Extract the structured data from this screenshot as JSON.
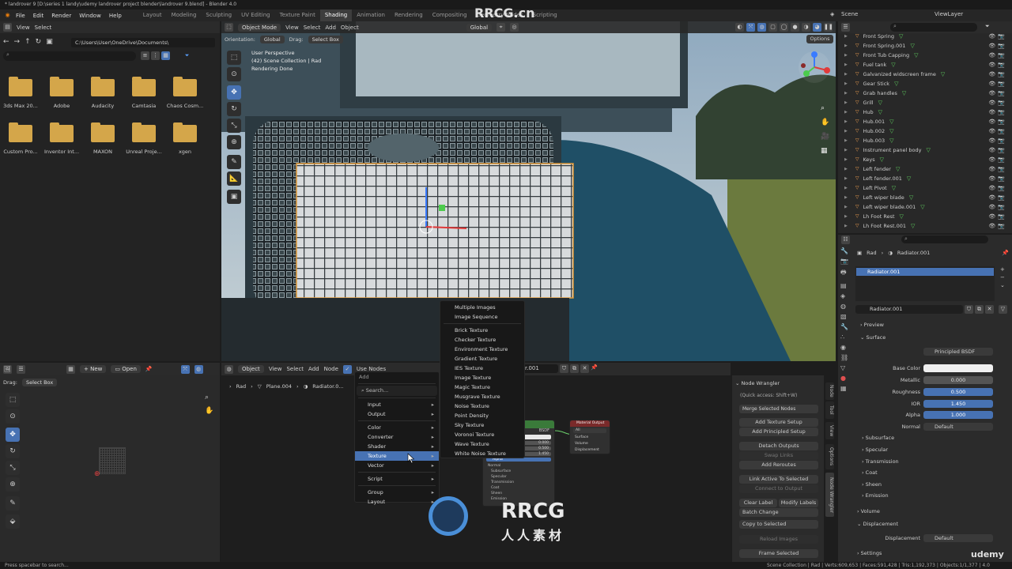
{
  "window_title": "* landrover 9 [D:\\series 1 landy\\udemy landrover project blender\\landrover 9.blend] - Blender 4.0",
  "menus": [
    "File",
    "Edit",
    "Render",
    "Window",
    "Help"
  ],
  "workspaces": [
    "Layout",
    "Modeling",
    "Sculpting",
    "UV Editing",
    "Texture Paint",
    "Shading",
    "Animation",
    "Rendering",
    "Compositing",
    "Geometry Nodes",
    "Scripting"
  ],
  "active_workspace": "Shading",
  "scene": {
    "label": "Scene",
    "view_layer": "ViewLayer"
  },
  "file_browser": {
    "menus": [
      "View",
      "Select"
    ],
    "path": "C:\\Users\\User\\OneDrive\\Documents\\",
    "folders": [
      "3ds Max 20...",
      "Adobe",
      "Audacity",
      "Camtasia",
      "Chaos Cosm...",
      "Custom Pro...",
      "Inventor Int...",
      "MAXON",
      "Unreal Proje...",
      "xgen"
    ]
  },
  "viewport": {
    "mode": "Object Mode",
    "menus": [
      "View",
      "Select",
      "Add",
      "Object"
    ],
    "transform": "Global",
    "orientation_label": "Orientation:",
    "orientation_value": "Global",
    "drag_label": "Drag:",
    "drag_value": "Select Box",
    "options": "Options",
    "overlay_lines": [
      "User Perspective",
      "(42) Scene Collection | Rad",
      "Rendering Done"
    ]
  },
  "outliner": {
    "items": [
      "Front Spring",
      "Front Spring.001",
      "Front Tub Capping",
      "Fuel tank",
      "Galvanized widscreen frame",
      "Gear Stick",
      "Grab handles",
      "Grill",
      "Hub",
      "Hub.001",
      "Hub.002",
      "Hub.003",
      "Instrument panel body",
      "Keys",
      "Left fender",
      "Left fender.001",
      "Left Pivot",
      "Left wiper blade",
      "Left wiper blade.001",
      "Lh Foot Rest",
      "Lh Foot Rest.001"
    ]
  },
  "properties": {
    "breadcrumb": [
      "Rad",
      "Radiator.001"
    ],
    "material_slot": "Radiator.001",
    "material_name": "Radiator.001",
    "panels": {
      "preview": "Preview",
      "surface": "Surface"
    },
    "surface_label": "Surface",
    "surface_value": "Principled BSDF",
    "fields": [
      {
        "label": "Base Color",
        "value": ""
      },
      {
        "label": "Metallic",
        "value": "0.000"
      },
      {
        "label": "Roughness",
        "value": "0.500"
      },
      {
        "label": "IOR",
        "value": "1.450"
      },
      {
        "label": "Alpha",
        "value": "1.000"
      },
      {
        "label": "Normal",
        "value": "Default"
      }
    ],
    "subpanels": [
      "Subsurface",
      "Specular",
      "Transmission",
      "Coat",
      "Sheen",
      "Emission"
    ],
    "volume": "Volume",
    "displacement": "Displacement",
    "displacement_label": "Displacement",
    "displacement_value": "Default",
    "settings": "Settings"
  },
  "image_editor": {
    "drag_label": "Drag:",
    "drag_value": "Select Box",
    "new": "New",
    "open": "Open"
  },
  "node_editor": {
    "object_type": "Object",
    "menus": [
      "View",
      "Select",
      "Add",
      "Node"
    ],
    "use_nodes": "Use Nodes",
    "material_field": "r.001",
    "breadcrumb": [
      "Rad",
      "Plane.004",
      "Radiator.0..."
    ],
    "output_node": {
      "title": "Material Output",
      "target": "All",
      "sockets": [
        "Surface",
        "Volume",
        "Displacement"
      ]
    },
    "bsdf_label": "BSDF",
    "bsdf_values": [
      "0.000",
      "0.500",
      "1.450"
    ],
    "bsdf_rows": [
      "Alpha",
      "Normal",
      "Subsurface",
      "Specular",
      "Transmission",
      "Coat",
      "Sheen",
      "Emission"
    ]
  },
  "add_menu": {
    "title": "Add",
    "search": "Search...",
    "groups": [
      [
        "Input",
        "Output"
      ],
      [
        "Color",
        "Converter",
        "Shader",
        "Texture",
        "Vector"
      ],
      [
        "Script"
      ],
      [
        "Group",
        "Layout"
      ]
    ],
    "highlight": "Texture"
  },
  "texture_submenu": {
    "groups": [
      [
        "Multiple Images",
        "Image Sequence"
      ],
      [
        "Brick Texture",
        "Checker Texture",
        "Environment Texture",
        "Gradient Texture",
        "IES Texture",
        "Image Texture",
        "Magic Texture",
        "Musgrave Texture",
        "Noise Texture",
        "Point Density",
        "Sky Texture",
        "Voronoi Texture",
        "Wave Texture",
        "White Noise Texture"
      ]
    ]
  },
  "node_wrangler": {
    "title": "Node Wrangler",
    "quick": "(Quick access: Shift+W)",
    "merge": "Merge Selected Nodes",
    "buttons": [
      "Add Texture Setup",
      "Add Principled Setup",
      "Detach Outputs",
      "Swap Links",
      "Add Reroutes",
      "Link Active To Selected",
      "Connect to Output",
      "Clear Label",
      "Modify Labels",
      "Batch Change",
      "Copy to Selected",
      "Reload Images",
      "Frame Selected"
    ],
    "tabs": [
      "Node",
      "Tool",
      "View",
      "Options",
      "Node Wrangler"
    ]
  },
  "status": {
    "left": "Press spacebar to search...",
    "right": "Scene Collection | Rad | Verts:609,653 | Faces:591,428 | Tris:1,192,373 | Objects:1/1,377 | 4.0"
  },
  "watermarks": [
    "RRCG.cn",
    "RRCG",
    "人人素材",
    "udemy"
  ],
  "colors": {
    "accent": "#4772b3",
    "folder": "#d4a64a",
    "active_workspace": "#3d3d3d",
    "node_green": "#3a7a3a",
    "node_red": "#7a2a2a"
  }
}
